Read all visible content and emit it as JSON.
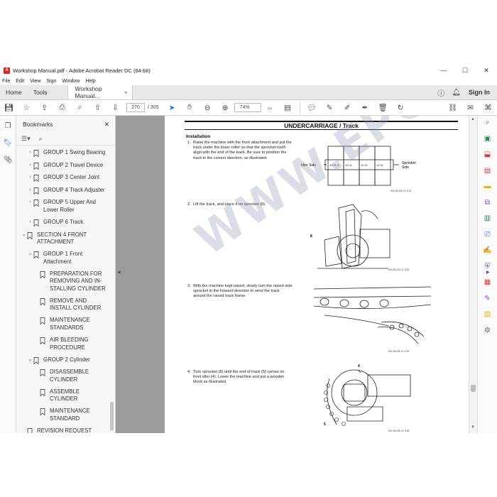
{
  "window": {
    "title": "Workshop Manual.pdf - Adobe Acrobat Reader DC (64-bit)",
    "minimize": "—",
    "maximize": "☐",
    "close": "✕"
  },
  "menu": [
    "File",
    "Edit",
    "View",
    "Sign",
    "Window",
    "Help"
  ],
  "tabs": {
    "home": "Home",
    "tools": "Tools",
    "document": "Workshop Manual...",
    "close": "×",
    "sign_in": "Sign In"
  },
  "toolbar": {
    "page_current": "270",
    "page_separator": "/",
    "page_total": "305",
    "zoom": "74%"
  },
  "bookmarks": {
    "title": "Bookmarks",
    "close": "✕",
    "items": [
      {
        "label": "GROUP 1 Swing Bearing",
        "indent": 1,
        "chevron": "›"
      },
      {
        "label": "GROUP 2 Travel Device",
        "indent": 1,
        "chevron": "›"
      },
      {
        "label": "GROUP 3 Center Joint",
        "indent": 1,
        "chevron": "›"
      },
      {
        "label": "GROUP 4 Track Adjuster",
        "indent": 1,
        "chevron": "›"
      },
      {
        "label": "GROUP 5 Upper And Lower Roller",
        "indent": 1,
        "chevron": "›"
      },
      {
        "label": "GROUP 6 Track",
        "indent": 1,
        "chevron": "›"
      },
      {
        "label": "SECTION 4 FRONT ATTACHMENT",
        "indent": 0,
        "chevron": "⌄"
      },
      {
        "label": "GROUP 1 Front Attachment",
        "indent": 1,
        "chevron": "⌄"
      },
      {
        "label": "PREPARATION FOR REMOVING AND IN-STALLING CYLINDER",
        "indent": 2,
        "chevron": ""
      },
      {
        "label": "REMOVE AND INSTALL CYLINDER",
        "indent": 2,
        "chevron": ""
      },
      {
        "label": "MAINTENANCE STANDARDS",
        "indent": 2,
        "chevron": ""
      },
      {
        "label": "AIR BLEEDING PROCEDURE",
        "indent": 2,
        "chevron": ""
      },
      {
        "label": "GROUP 2 Cylinder",
        "indent": 1,
        "chevron": "⌄"
      },
      {
        "label": "DISASSEMBLE CYLINDER",
        "indent": 2,
        "chevron": ""
      },
      {
        "label": "ASSEMBLE CYLINDER",
        "indent": 2,
        "chevron": ""
      },
      {
        "label": "MAINTENANCE STANDARD",
        "indent": 2,
        "chevron": ""
      },
      {
        "label": "REVISION REQUEST FORM",
        "indent": 0,
        "chevron": ""
      }
    ]
  },
  "page": {
    "header": "UNDERCARRIAGE / Track",
    "section": "Installation",
    "steps": [
      {
        "num": "1.",
        "text": "Raise the machine with the front attachment and put the track under the lower roller so that the sprocket tooth align with the end of the track. Be sure to position the track in the correct direction, as illustrated."
      },
      {
        "num": "2.",
        "text": "Lift the track, and place it on sprocket (8)."
      },
      {
        "num": "3.",
        "text": "With the machine kept raised, slowly turn the raised side sprocket in the forward direction to wind the track around the raised track frame."
      },
      {
        "num": "4.",
        "text": "Turn sprocket (8) until the end of track (5) comes on front idler (4). Lower the machine and put a wooden block as illustrated."
      }
    ],
    "fig1": {
      "left_label": "Idler Side",
      "right_label": "Sprocket Side",
      "code": "W1VB-05-07-015"
    },
    "fig2": {
      "callout": "8",
      "code": "W1VB-05-07-016"
    },
    "fig3": {
      "code": "W1VB-05-07-019"
    },
    "fig4": {
      "callout_a": "4",
      "callout_b": "5",
      "code": "W1VB-05-07-018"
    },
    "watermark": "WWW.EPCDEPOT.COM"
  }
}
